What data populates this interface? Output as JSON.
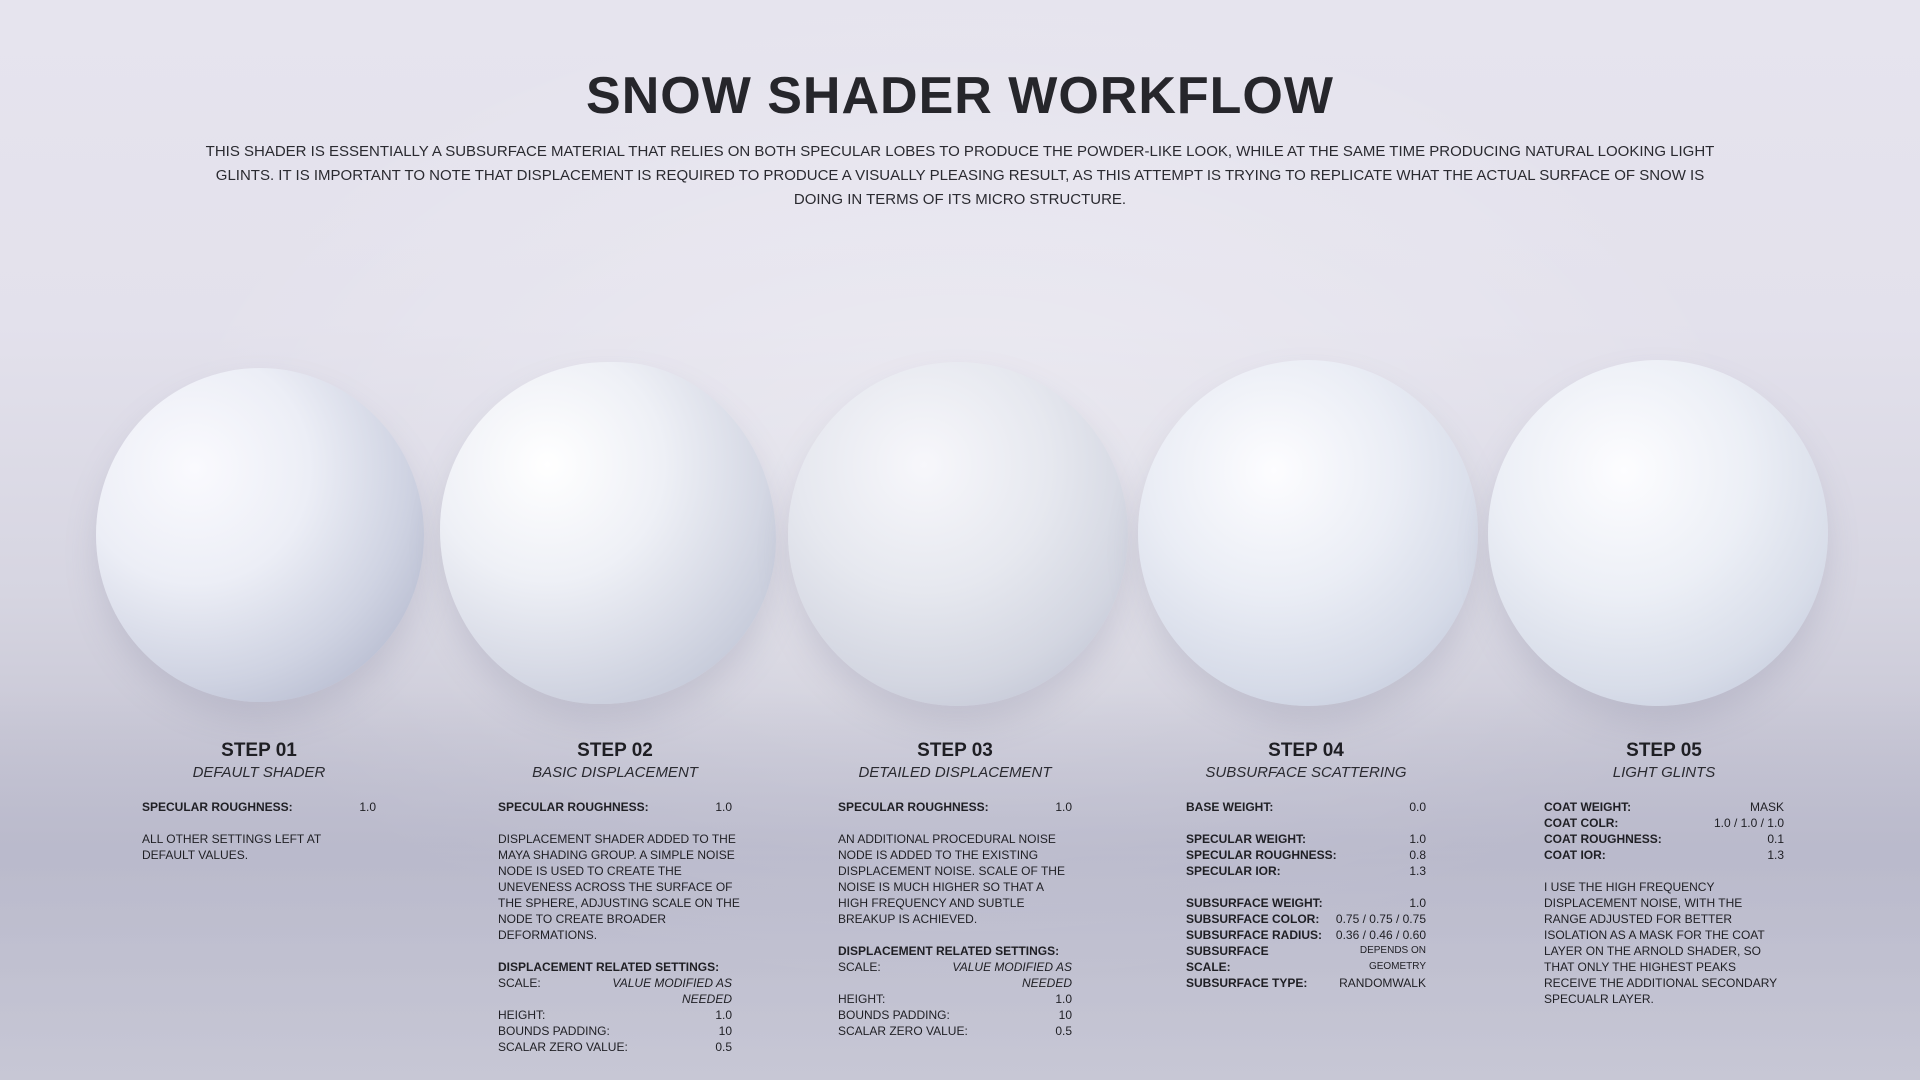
{
  "header": {
    "title": "SNOW SHADER WORKFLOW",
    "intro": "THIS SHADER IS ESSENTIALLY A SUBSURFACE MATERIAL THAT RELIES ON BOTH SPECULAR LOBES TO PRODUCE THE POWDER-LIKE LOOK, WHILE AT THE SAME TIME PRODUCING NATURAL LOOKING LIGHT GLINTS. IT IS IMPORTANT TO NOTE THAT DISPLACEMENT IS REQUIRED TO PRODUCE A VISUALLY PLEASING RESULT, AS THIS ATTEMPT IS TRYING TO REPLICATE WHAT THE ACTUAL SURFACE OF SNOW IS DOING IN TERMS OF ITS MICRO STRUCTURE."
  },
  "steps": [
    {
      "title": "STEP 01",
      "subtitle": "DEFAULT SHADER",
      "params": [
        {
          "k": "SPECULAR ROUGHNESS:",
          "v": "1.0"
        }
      ],
      "desc": "ALL OTHER SETTINGS LEFT AT DEFAULT VALUES."
    },
    {
      "title": "STEP 02",
      "subtitle": "BASIC DISPLACEMENT",
      "params": [
        {
          "k": "SPECULAR ROUGHNESS:",
          "v": "1.0"
        }
      ],
      "desc": "DISPLACEMENT SHADER ADDED TO THE MAYA SHADING GROUP. A SIMPLE NOISE NODE IS USED TO CREATE THE UNEVENESS ACROSS THE SURFACE OF THE SPHERE, ADJUSTING SCALE ON THE NODE TO CREATE BROADER DEFORMATIONS.",
      "settings_heading": "DISPLACEMENT RELATED SETTINGS:",
      "settings": [
        {
          "k": "SCALE:",
          "v": "VALUE MODIFIED AS NEEDED"
        },
        {
          "k": "HEIGHT:",
          "v": "1.0"
        },
        {
          "k": "BOUNDS PADDING:",
          "v": "10"
        },
        {
          "k": "SCALAR ZERO VALUE:",
          "v": "0.5"
        }
      ]
    },
    {
      "title": "STEP 03",
      "subtitle": "DETAILED DISPLACEMENT",
      "params": [
        {
          "k": "SPECULAR ROUGHNESS:",
          "v": "1.0"
        }
      ],
      "desc": "AN ADDITIONAL PROCEDURAL NOISE NODE IS ADDED TO THE EXISTING DISPLACEMENT NOISE. SCALE OF THE NOISE IS MUCH HIGHER SO THAT A HIGH FREQUENCY AND SUBTLE BREAKUP IS ACHIEVED.",
      "settings_heading": "DISPLACEMENT RELATED SETTINGS:",
      "settings": [
        {
          "k": "SCALE:",
          "v": "VALUE MODIFIED AS NEEDED"
        },
        {
          "k": "HEIGHT:",
          "v": "1.0"
        },
        {
          "k": "BOUNDS PADDING:",
          "v": "10"
        },
        {
          "k": "SCALAR ZERO VALUE:",
          "v": "0.5"
        }
      ]
    },
    {
      "title": "STEP 04",
      "subtitle": "SUBSURFACE SCATTERING",
      "params_a": [
        {
          "k": "BASE WEIGHT:",
          "v": "0.0"
        }
      ],
      "params_b": [
        {
          "k": "SPECULAR WEIGHT:",
          "v": "1.0"
        },
        {
          "k": "SPECULAR ROUGHNESS:",
          "v": "0.8"
        },
        {
          "k": "SPECULAR IOR:",
          "v": "1.3"
        }
      ],
      "params_c": [
        {
          "k": "SUBSURFACE WEIGHT:",
          "v": "1.0"
        },
        {
          "k": "SUBSURFACE COLOR:",
          "v": "0.75 / 0.75 / 0.75"
        },
        {
          "k": "SUBSURFACE RADIUS:",
          "v": "0.36 / 0.46 / 0.60"
        },
        {
          "k": "SUBSURFACE SCALE:",
          "v": "DEPENDS ON GEOMETRY"
        },
        {
          "k": "SUBSURFACE TYPE:",
          "v": "RANDOMWALK"
        }
      ]
    },
    {
      "title": "STEP 05",
      "subtitle": "LIGHT GLINTS",
      "params": [
        {
          "k": "COAT WEIGHT:",
          "v": "MASK"
        },
        {
          "k": "COAT COLR:",
          "v": "1.0 / 1.0 / 1.0"
        },
        {
          "k": "COAT ROUGHNESS:",
          "v": "0.1"
        },
        {
          "k": "COAT IOR:",
          "v": "1.3"
        }
      ],
      "desc": "I USE THE HIGH FREQUENCY DISPLACEMENT NOISE, WITH THE RANGE ADJUSTED FOR BETTER ISOLATION AS A MASK FOR THE COAT LAYER ON THE ARNOLD SHADER, SO THAT ONLY THE HIGHEST PEAKS RECEIVE THE ADDITIONAL SECONDARY SPECUALR LAYER."
    }
  ]
}
